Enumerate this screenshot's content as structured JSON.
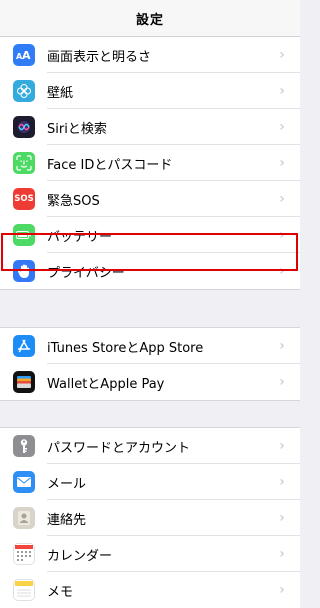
{
  "nav": {
    "title": "設定"
  },
  "groups": [
    {
      "items": [
        {
          "label": "",
          "icon": "gear-icon"
        },
        {
          "label": "画面表示と明るさ",
          "icon": "text-size-icon"
        },
        {
          "label": "壁紙",
          "icon": "wallpaper-flower-icon"
        },
        {
          "label": "Siriと検索",
          "icon": "siri-icon"
        },
        {
          "label": "Face IDとパスコード",
          "icon": "face-id-icon"
        },
        {
          "label": "緊急SOS",
          "icon_text": "SOS",
          "icon": "sos-icon"
        },
        {
          "label": "バッテリー",
          "icon": "battery-icon"
        },
        {
          "label": "プライバシー",
          "icon": "privacy-hand-icon",
          "highlighted": true
        }
      ]
    },
    {
      "items": [
        {
          "label": "iTunes StoreとApp Store",
          "icon": "app-store-icon"
        },
        {
          "label": "WalletとApple Pay",
          "icon": "wallet-icon"
        }
      ]
    },
    {
      "items": [
        {
          "label": "パスワードとアカウント",
          "icon": "key-icon"
        },
        {
          "label": "メール",
          "icon": "mail-icon"
        },
        {
          "label": "連絡先",
          "icon": "contacts-icon"
        },
        {
          "label": "カレンダー",
          "icon": "calendar-icon"
        },
        {
          "label": "メモ",
          "icon": "notes-icon"
        }
      ]
    }
  ],
  "colors": {
    "highlight_border": "#e00000",
    "chevron": "#c4c4c7"
  }
}
